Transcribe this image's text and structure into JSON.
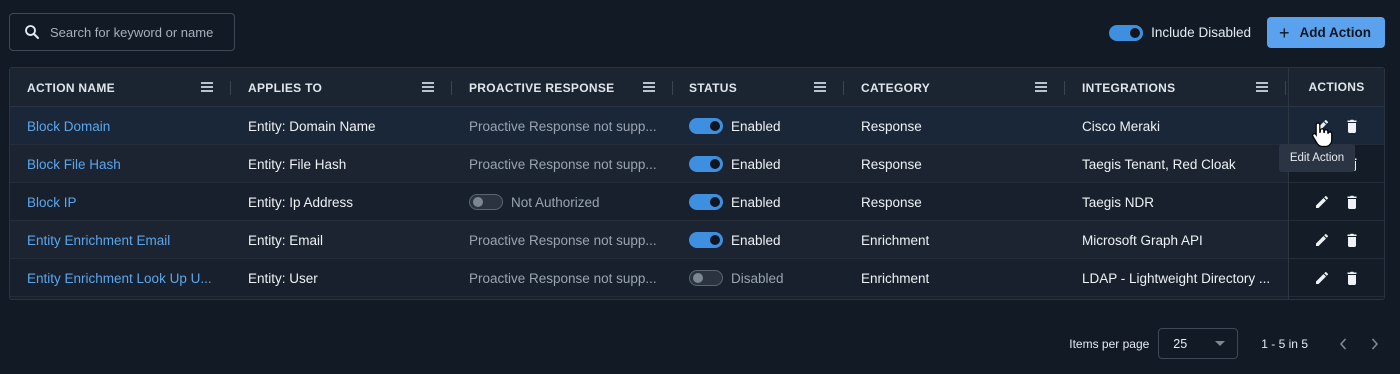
{
  "search": {
    "placeholder": "Search for keyword or name"
  },
  "toolbar": {
    "include_disabled_label": "Include Disabled",
    "include_disabled_on": true,
    "add_action_label": "Add Action",
    "accent": "#5aa2ee"
  },
  "table": {
    "columns": [
      "ACTION NAME",
      "APPLIES TO",
      "PROACTIVE RESPONSE",
      "STATUS",
      "CATEGORY",
      "INTEGRATIONS"
    ],
    "actions_header": "ACTIONS",
    "rows": [
      {
        "name": "Block Domain",
        "applies_to": "Entity: Domain Name",
        "proactive": "Proactive Response not supp...",
        "proactive_toggle": false,
        "status_on": true,
        "status": "Enabled",
        "category": "Response",
        "integrations": "Cisco Meraki"
      },
      {
        "name": "Block File Hash",
        "applies_to": "Entity: File Hash",
        "proactive": "Proactive Response not supp...",
        "proactive_toggle": false,
        "status_on": true,
        "status": "Enabled",
        "category": "Response",
        "integrations": "Taegis Tenant, Red Cloak"
      },
      {
        "name": "Block IP",
        "applies_to": "Entity: Ip Address",
        "proactive": "Not Authorized",
        "proactive_toggle": true,
        "status_on": true,
        "status": "Enabled",
        "category": "Response",
        "integrations": "Taegis NDR"
      },
      {
        "name": "Entity Enrichment Email",
        "applies_to": "Entity: Email",
        "proactive": "Proactive Response not supp...",
        "proactive_toggle": false,
        "status_on": true,
        "status": "Enabled",
        "category": "Enrichment",
        "integrations": "Microsoft Graph API"
      },
      {
        "name": "Entity Enrichment Look Up U...",
        "applies_to": "Entity: User",
        "proactive": "Proactive Response not supp...",
        "proactive_toggle": false,
        "status_on": false,
        "status": "Disabled",
        "category": "Enrichment",
        "integrations": "LDAP - Lightweight Directory ..."
      }
    ]
  },
  "tooltip": {
    "text": "Edit Action"
  },
  "pagination": {
    "items_per_page_label": "Items per page",
    "page_size": "25",
    "range": "1 - 5 in 5"
  },
  "icons": [
    "search-icon",
    "plus-icon",
    "column-menu-icon",
    "edit-icon",
    "delete-icon",
    "chevron-left-icon",
    "chevron-right-icon",
    "hand-cursor-icon"
  ]
}
